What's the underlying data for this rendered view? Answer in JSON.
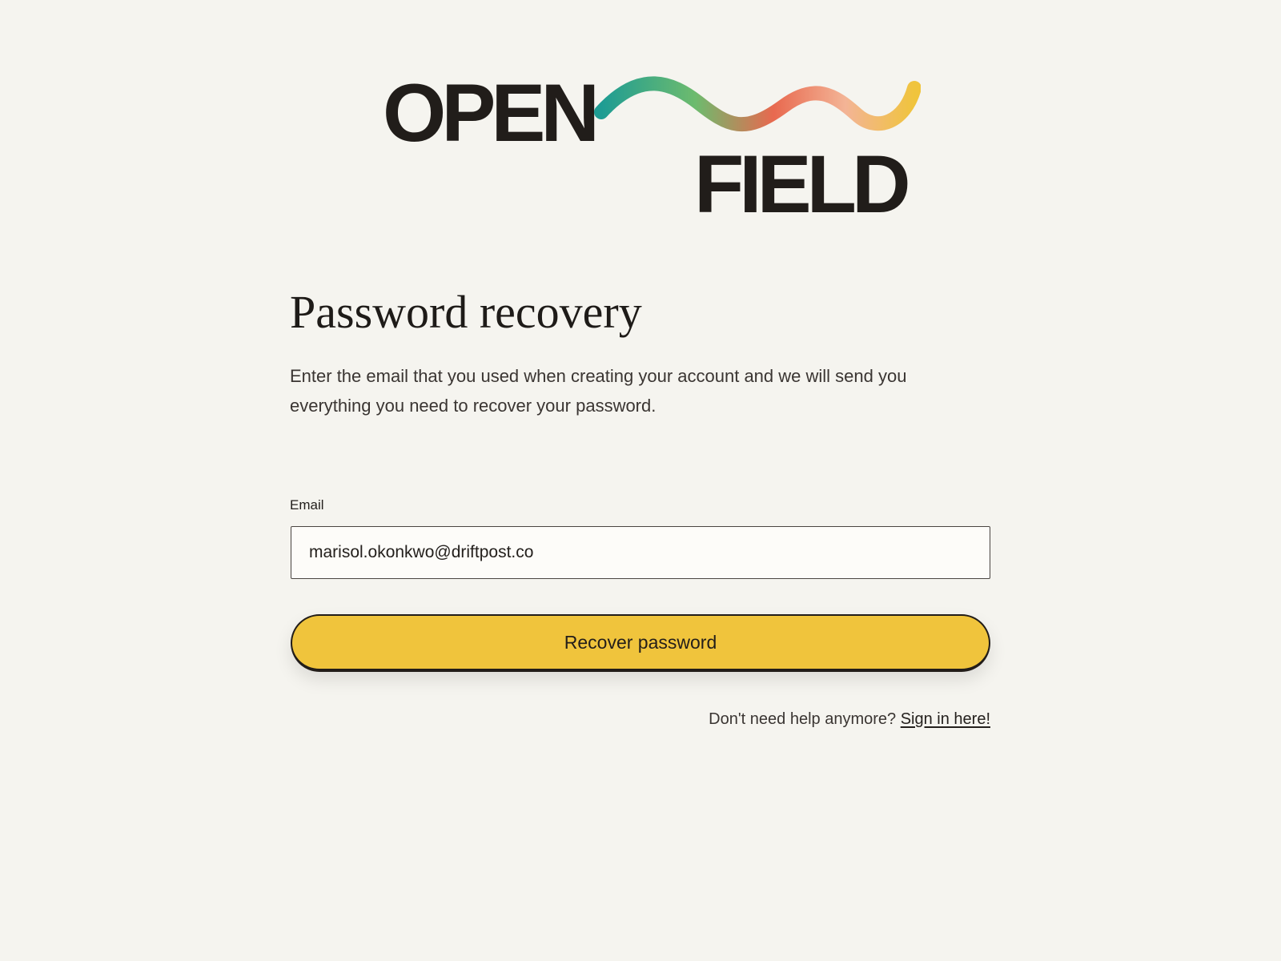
{
  "brand": {
    "word_top": "OPEN",
    "word_bottom": "FIELD",
    "wave_colors": [
      "#1e9c93",
      "#6dbb6e",
      "#e8694f",
      "#f3b496",
      "#f0c43c"
    ]
  },
  "form": {
    "title": "Password recovery",
    "description": "Enter the email that you used when creating your account and we will send you everything you need to recover your password.",
    "email_label": "Email",
    "email_value": "marisol.okonkwo@driftpost.co",
    "submit_label": "Recover password"
  },
  "footer": {
    "prompt": "Don't need help anymore?",
    "link_label": "Sign in here!"
  },
  "colors": {
    "background": "#f5f4ef",
    "button": "#f0c43c",
    "text": "#24201d"
  }
}
